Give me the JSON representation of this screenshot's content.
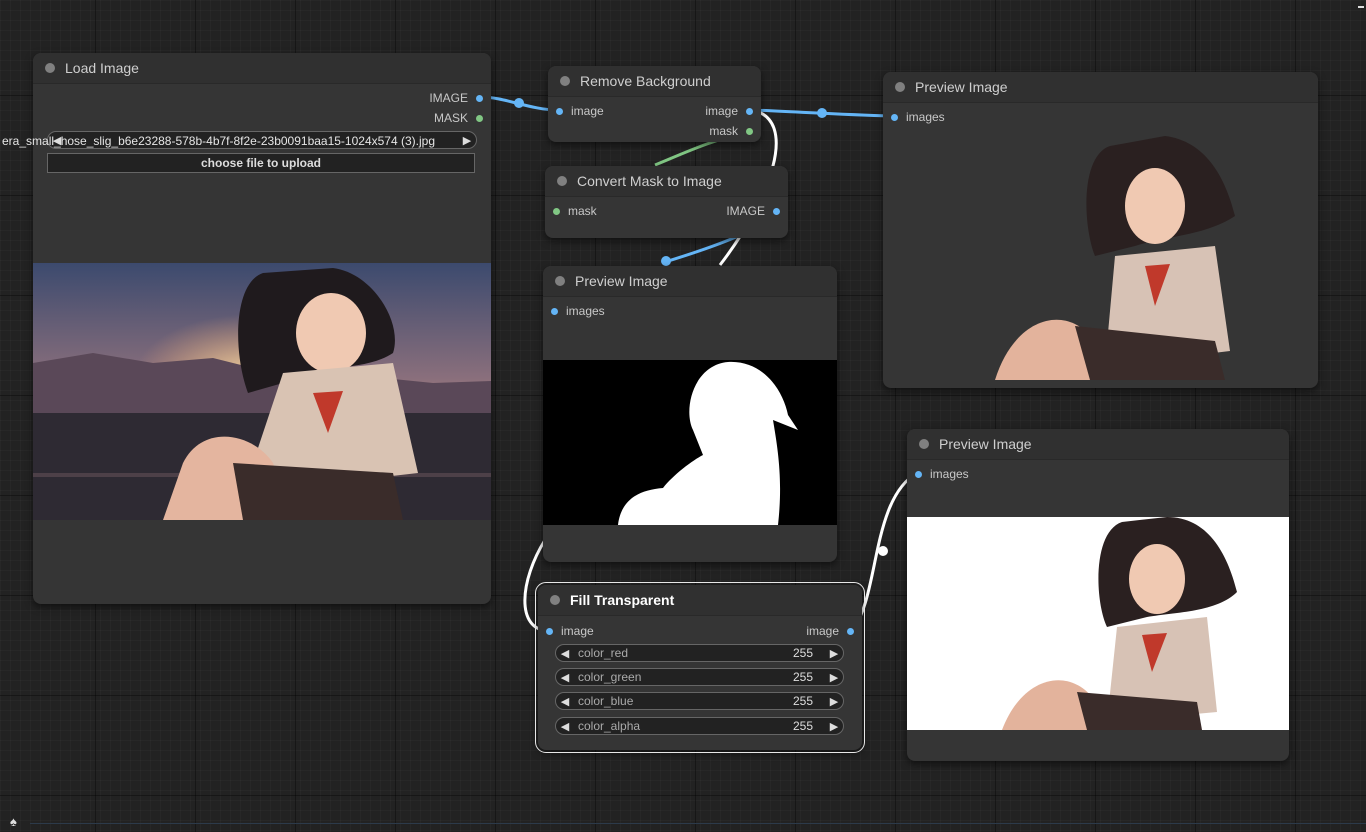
{
  "nodes": {
    "load_image": {
      "title": "Load Image",
      "outputs": [
        "IMAGE",
        "MASK"
      ],
      "image_value": "era_small_hose_slig_b6e23288-578b-4b7f-8f2e-23b0091baa15-1024x574 (3).jpg",
      "upload_label": "choose file to upload"
    },
    "remove_bg": {
      "title": "Remove Background",
      "inputs": [
        "image"
      ],
      "outputs": [
        "image",
        "mask"
      ]
    },
    "convert_mask": {
      "title": "Convert Mask to Image",
      "inputs": [
        "mask"
      ],
      "outputs": [
        "IMAGE"
      ]
    },
    "preview_mask": {
      "title": "Preview Image",
      "inputs": [
        "images"
      ]
    },
    "preview_top": {
      "title": "Preview Image",
      "inputs": [
        "images"
      ]
    },
    "preview_bottom": {
      "title": "Preview Image",
      "inputs": [
        "images"
      ]
    },
    "fill_transparent": {
      "title": "Fill Transparent",
      "inputs": [
        "image"
      ],
      "outputs": [
        "image"
      ],
      "widgets": [
        {
          "label": "color_red",
          "value": "255"
        },
        {
          "label": "color_green",
          "value": "255"
        },
        {
          "label": "color_blue",
          "value": "255"
        },
        {
          "label": "color_alpha",
          "value": "255"
        }
      ]
    }
  },
  "colors": {
    "canvas": "#222222",
    "node_body": "#353535",
    "image_link": "#64b5f6",
    "mask_link": "#81c784",
    "selected_link": "#ffffff"
  },
  "icons": {
    "bottom_left": "spade-icon"
  }
}
